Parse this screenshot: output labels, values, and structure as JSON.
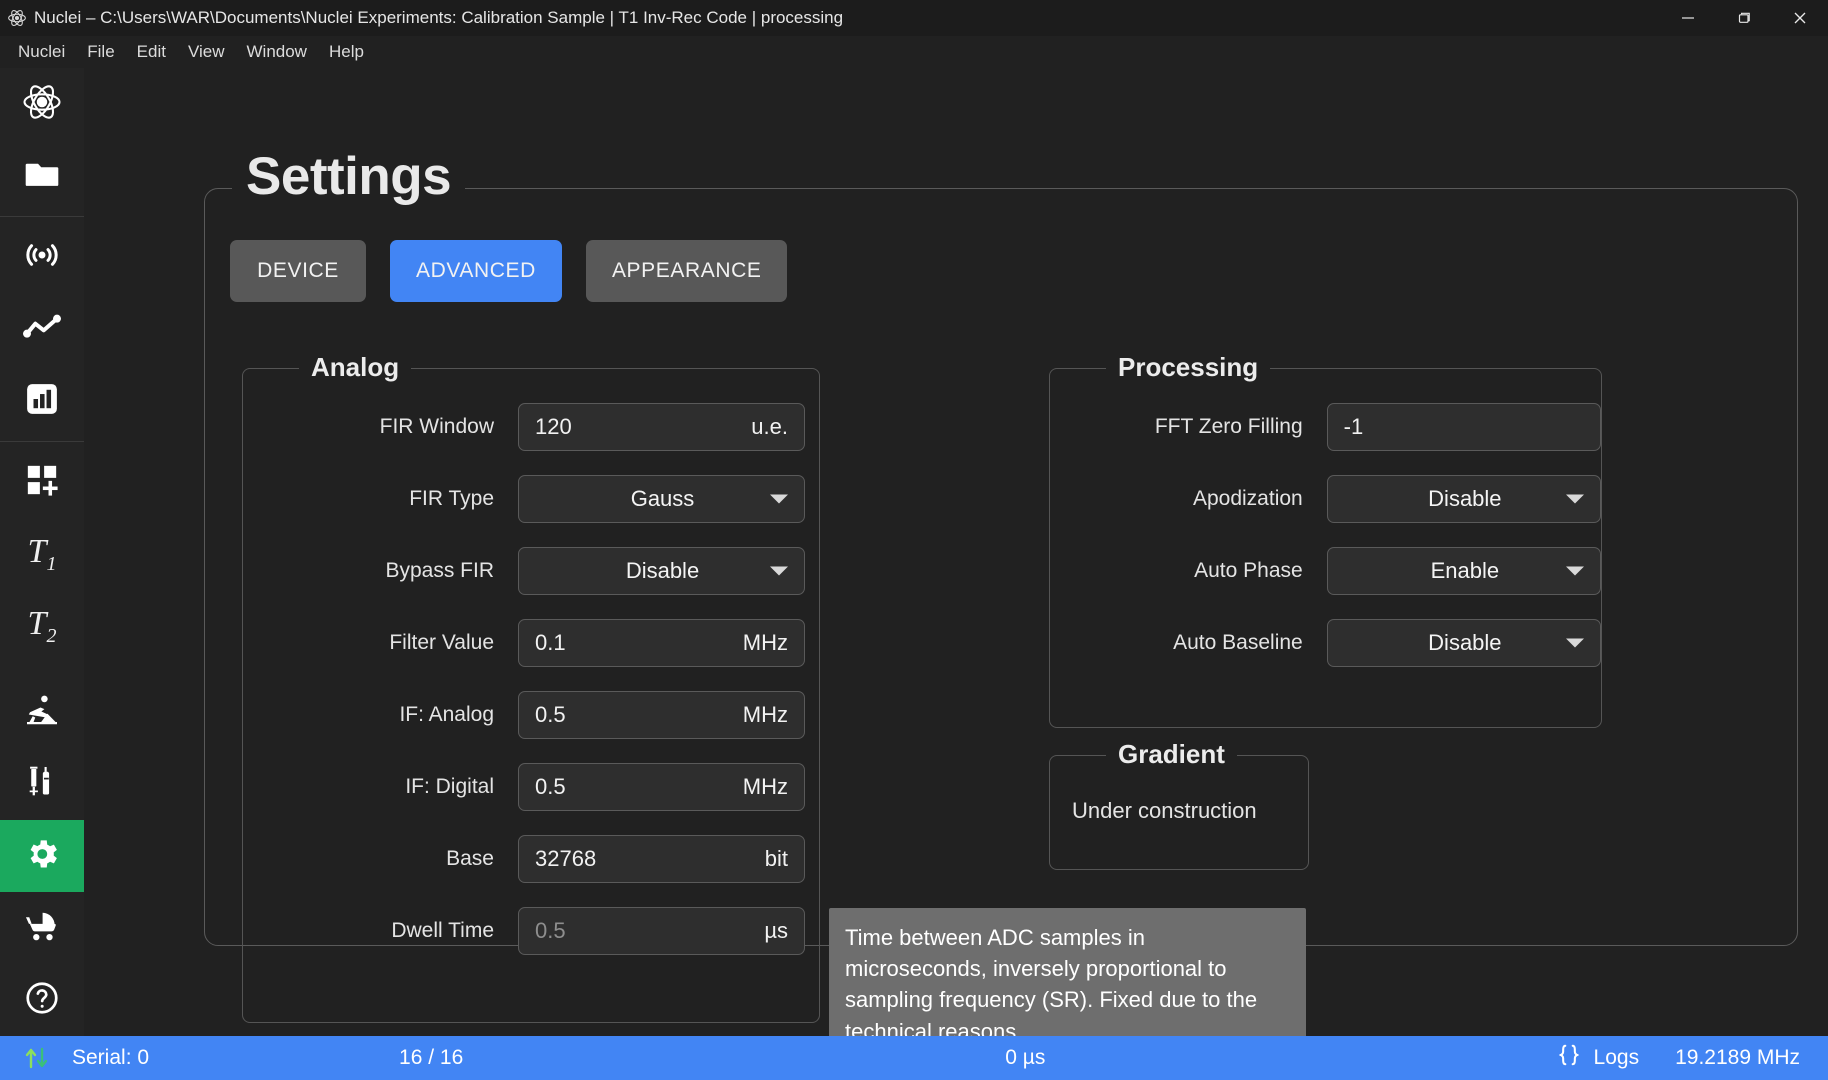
{
  "window": {
    "title": "Nuclei – C:\\Users\\WAR\\Documents\\Nuclei Experiments: Calibration Sample | T1 Inv-Rec Code | processing",
    "app_icon": "atom-icon",
    "minimize": "minimize-button",
    "maximize": "maximize-button",
    "close": "close-button"
  },
  "menubar": {
    "items": [
      {
        "label": "Nuclei"
      },
      {
        "label": "File"
      },
      {
        "label": "Edit"
      },
      {
        "label": "View"
      },
      {
        "label": "Window"
      },
      {
        "label": "Help"
      }
    ]
  },
  "sidebar": {
    "items": [
      {
        "name": "logo",
        "icon": "atom-logo-icon",
        "label": ""
      },
      {
        "name": "files",
        "icon": "folder-icon",
        "label": ""
      },
      {
        "name": "signal",
        "icon": "broadcast-signal-icon",
        "label": ""
      },
      {
        "name": "line-chart",
        "icon": "line-chart-icon",
        "label": ""
      },
      {
        "name": "bar-chart",
        "icon": "bar-chart-icon",
        "label": ""
      },
      {
        "name": "add-module",
        "icon": "grid-plus-icon",
        "label": ""
      },
      {
        "name": "t1",
        "icon": "t1-icon",
        "label": "T",
        "sub": "1"
      },
      {
        "name": "t2",
        "icon": "t2-icon",
        "label": "T",
        "sub": "2"
      },
      {
        "name": "construction",
        "icon": "construction-worker-icon",
        "label": ""
      },
      {
        "name": "samples",
        "icon": "syringe-vial-icon",
        "label": ""
      },
      {
        "name": "settings",
        "icon": "gear-icon",
        "label": "",
        "active": true
      },
      {
        "name": "stroller",
        "icon": "stroller-icon",
        "label": ""
      },
      {
        "name": "help",
        "icon": "question-circle-icon",
        "label": ""
      }
    ],
    "active_color": "#1ba95e"
  },
  "page": {
    "title": "Settings"
  },
  "tabs": [
    {
      "label": "DEVICE",
      "active": false
    },
    {
      "label": "ADVANCED",
      "active": true
    },
    {
      "label": "APPEARANCE",
      "active": false
    }
  ],
  "accent_color": "#4285f4",
  "analog": {
    "legend": "Analog",
    "fields": [
      {
        "label": "FIR Window",
        "type": "input",
        "value": "120",
        "unit": "u.e.",
        "disabled": false
      },
      {
        "label": "FIR Type",
        "type": "select",
        "value": "Gauss",
        "unit": ""
      },
      {
        "label": "Bypass FIR",
        "type": "select",
        "value": "Disable",
        "unit": ""
      },
      {
        "label": "Filter Value",
        "type": "input",
        "value": "0.1",
        "unit": "MHz",
        "disabled": false
      },
      {
        "label": "IF: Analog",
        "type": "input",
        "value": "0.5",
        "unit": "MHz",
        "disabled": false
      },
      {
        "label": "IF: Digital",
        "type": "input",
        "value": "0.5",
        "unit": "MHz",
        "disabled": false
      },
      {
        "label": "Base",
        "type": "input",
        "value": "32768",
        "unit": "bit",
        "disabled": false
      },
      {
        "label": "Dwell Time",
        "type": "input",
        "value": "0.5",
        "unit": "µs",
        "disabled": true
      }
    ]
  },
  "processing": {
    "legend": "Processing",
    "fields": [
      {
        "label": "FFT Zero Filling",
        "type": "input",
        "value": "-1",
        "unit": ""
      },
      {
        "label": "Apodization",
        "type": "select",
        "value": "Disable",
        "unit": ""
      },
      {
        "label": "Auto Phase",
        "type": "select",
        "value": "Enable",
        "unit": ""
      },
      {
        "label": "Auto Baseline",
        "type": "select",
        "value": "Disable",
        "unit": ""
      }
    ]
  },
  "gradient": {
    "legend": "Gradient",
    "text": "Under construction"
  },
  "tooltip": {
    "text": "Time between ADC samples in microseconds, inversely proportional to sampling frequency (SR). Fixed due to the technical reasons"
  },
  "statusbar": {
    "transfer_icon": "up-down-arrows-icon",
    "serial": "Serial: 0",
    "count": "16 / 16",
    "progress_percent": 100,
    "progress_color": "#9be36a",
    "time": "0 µs",
    "logs_icon": "braces-icon",
    "logs": "Logs",
    "frequency": "19.2189 MHz",
    "background": "#4285f4"
  }
}
